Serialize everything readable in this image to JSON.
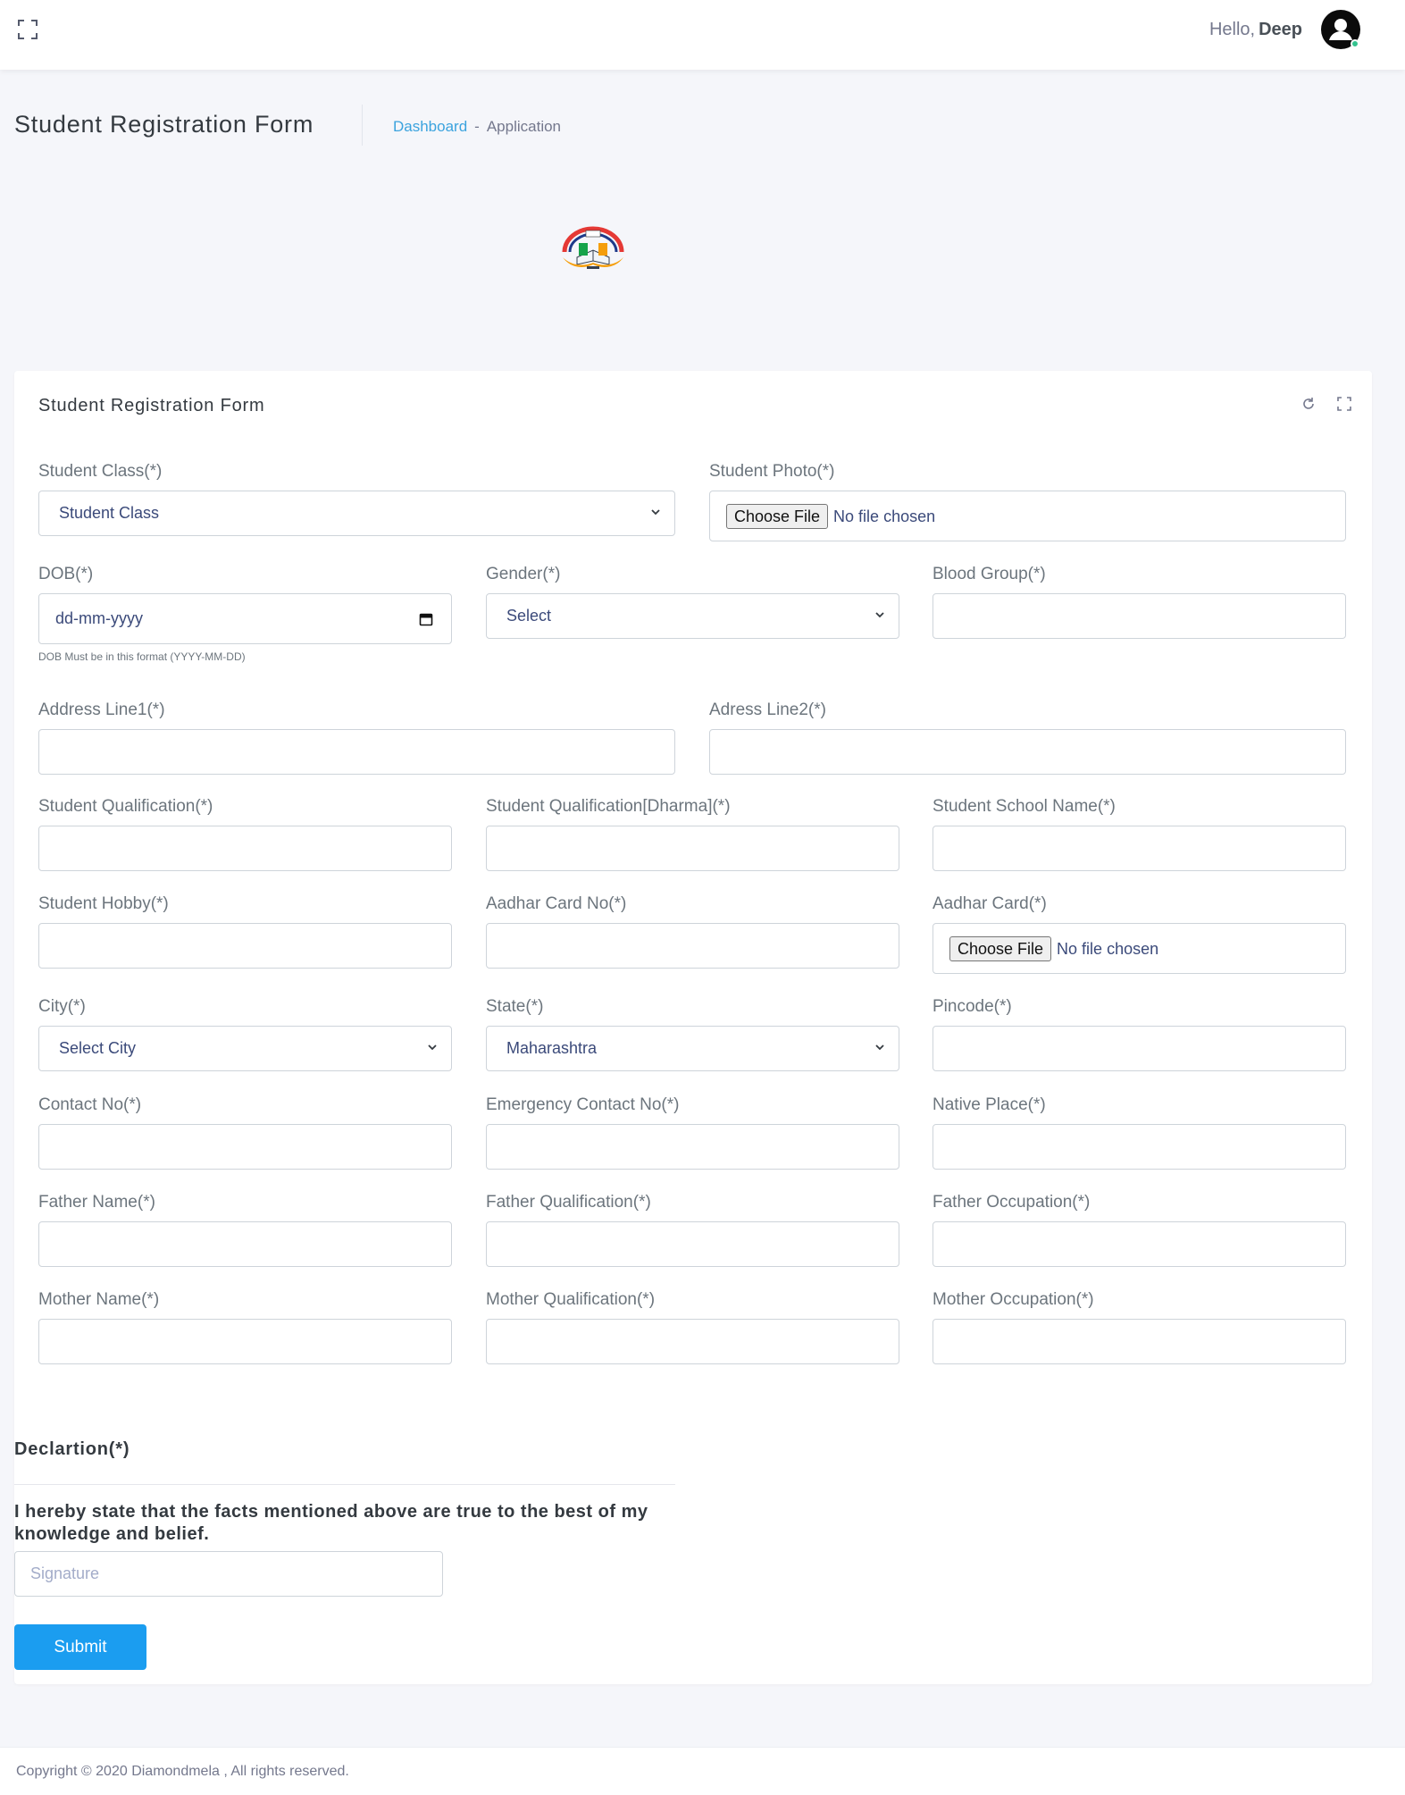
{
  "header": {
    "greeting": "Hello,",
    "user_name": "Deep"
  },
  "page": {
    "title": "Student Registration Form",
    "breadcrumb": [
      "Dashboard",
      "-",
      "Application"
    ]
  },
  "card": {
    "title": "Student Registration Form"
  },
  "form": {
    "student_class": {
      "label": "Student Class(*)",
      "value": "Student Class"
    },
    "student_photo": {
      "label": "Student Photo(*)",
      "button": "Choose File",
      "status": "No file chosen"
    },
    "dob": {
      "label": "DOB(*)",
      "value": "dd-mm-yyyy",
      "help": "DOB Must be in this format (YYYY-MM-DD)"
    },
    "gender": {
      "label": "Gender(*)",
      "value": "Select"
    },
    "blood_group": {
      "label": "Blood Group(*)",
      "value": ""
    },
    "address1": {
      "label": "Address Line1(*)",
      "value": ""
    },
    "address2": {
      "label": "Adress Line2(*)",
      "value": ""
    },
    "qualification": {
      "label": "Student Qualification(*)",
      "value": ""
    },
    "qualification_dharma": {
      "label": "Student Qualification[Dharma](*)",
      "value": ""
    },
    "school_name": {
      "label": "Student School Name(*)",
      "value": ""
    },
    "hobby": {
      "label": "Student Hobby(*)",
      "value": ""
    },
    "aadhar_no": {
      "label": "Aadhar Card No(*)",
      "value": ""
    },
    "aadhar_card": {
      "label": "Aadhar Card(*)",
      "button": "Choose File",
      "status": "No file chosen"
    },
    "city": {
      "label": "City(*)",
      "value": "Select City"
    },
    "state": {
      "label": "State(*)",
      "value": "Maharashtra"
    },
    "pincode": {
      "label": "Pincode(*)",
      "value": ""
    },
    "contact_no": {
      "label": "Contact No(*)",
      "value": ""
    },
    "emergency_contact": {
      "label": "Emergency Contact No(*)",
      "value": ""
    },
    "native_place": {
      "label": "Native Place(*)",
      "value": ""
    },
    "father_name": {
      "label": "Father Name(*)",
      "value": ""
    },
    "father_qualification": {
      "label": "Father Qualification(*)",
      "value": ""
    },
    "father_occupation": {
      "label": "Father Occupation(*)",
      "value": ""
    },
    "mother_name": {
      "label": "Mother Name(*)",
      "value": ""
    },
    "mother_qualification": {
      "label": "Mother Qualification(*)",
      "value": ""
    },
    "mother_occupation": {
      "label": "Mother Occupation(*)",
      "value": ""
    }
  },
  "declaration": {
    "title": "Declartion(*)",
    "text": "I hereby state that the facts mentioned above are true to the best of my knowledge and belief.",
    "signature_placeholder": "Signature",
    "submit_label": "Submit"
  },
  "footer": {
    "copyright": "Copyright © 2020 Diamondmela , All rights reserved."
  },
  "icons": {
    "fullscreen": "fullscreen-icon",
    "avatar": "user-avatar-icon",
    "refresh": "refresh-icon",
    "expand": "expand-icon",
    "chevron": "chevron-down-icon",
    "calendar": "calendar-icon"
  },
  "colors": {
    "accent": "#1b9df0",
    "link": "#3ba3de",
    "online": "#34c38f",
    "background": "#f5f6fa"
  }
}
